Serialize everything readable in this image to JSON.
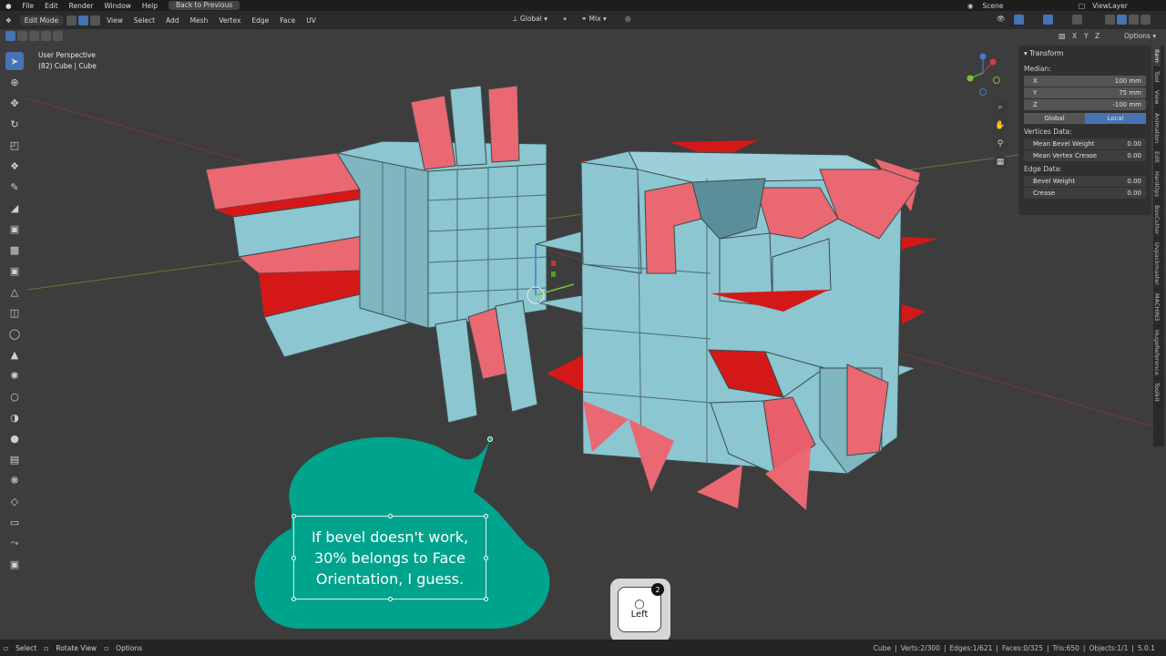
{
  "menu": {
    "items": [
      "File",
      "Edit",
      "Render",
      "Window",
      "Help"
    ],
    "back_label": "Back to Previous",
    "scene": "Scene",
    "view_layer": "ViewLayer"
  },
  "header": {
    "mode": "Edit Mode",
    "menus": [
      "View",
      "Select",
      "Add",
      "Mesh",
      "Vertex",
      "Edge",
      "Face",
      "UV"
    ],
    "orientation": "Global",
    "snap": "Mix",
    "axes": [
      "X",
      "Y",
      "Z"
    ],
    "options": "Options"
  },
  "viewport": {
    "perspective": "User Perspective",
    "object_info": "(82) Cube | Cube"
  },
  "npanel": {
    "title": "Transform",
    "median_label": "Median:",
    "x_label": "X",
    "x_value": "100 mm",
    "y_label": "Y",
    "y_value": "75 mm",
    "z_label": "Z",
    "z_value": "-100 mm",
    "global": "Global",
    "local": "Local",
    "vertices_data": "Vertices Data:",
    "mean_bevel_weight": "Mean Bevel Weight",
    "mean_bevel_weight_value": "0.00",
    "mean_vertex_crease": "Mean Vertex Crease",
    "mean_vertex_crease_value": "0.00",
    "edge_data": "Edge Data:",
    "bevel_weight": "Bevel Weight",
    "bevel_weight_value": "0.00",
    "crease": "Crease",
    "crease_value": "0.00"
  },
  "side_tabs": [
    "Item",
    "Tool",
    "View",
    "Animation",
    "Edit",
    "HardOps",
    "BoxCutter",
    "Uvpackmaster",
    "MACHIN3",
    "HugeReference",
    "Toolkit"
  ],
  "caption": {
    "line1": "If bevel doesn't work,",
    "line2": "30% belongs to Face",
    "line3": "Orientation, I guess."
  },
  "key_overlay": {
    "label": "Left",
    "count": "2"
  },
  "status": {
    "select": "Select",
    "rotate": "Rotate View",
    "options": "Options",
    "object": "Cube",
    "verts": "Verts:2/300",
    "edges": "Edges:1/621",
    "faces": "Faces:0/325",
    "tris": "Tris:650",
    "objects": "Objects:1/1",
    "version": "5.0.1"
  },
  "colors": {
    "face_front": "#8cc6d0",
    "face_back": "#e85e6a",
    "face_back_dark": "#d41818",
    "bubble": "#00a48d",
    "accent": "#4772b3"
  }
}
